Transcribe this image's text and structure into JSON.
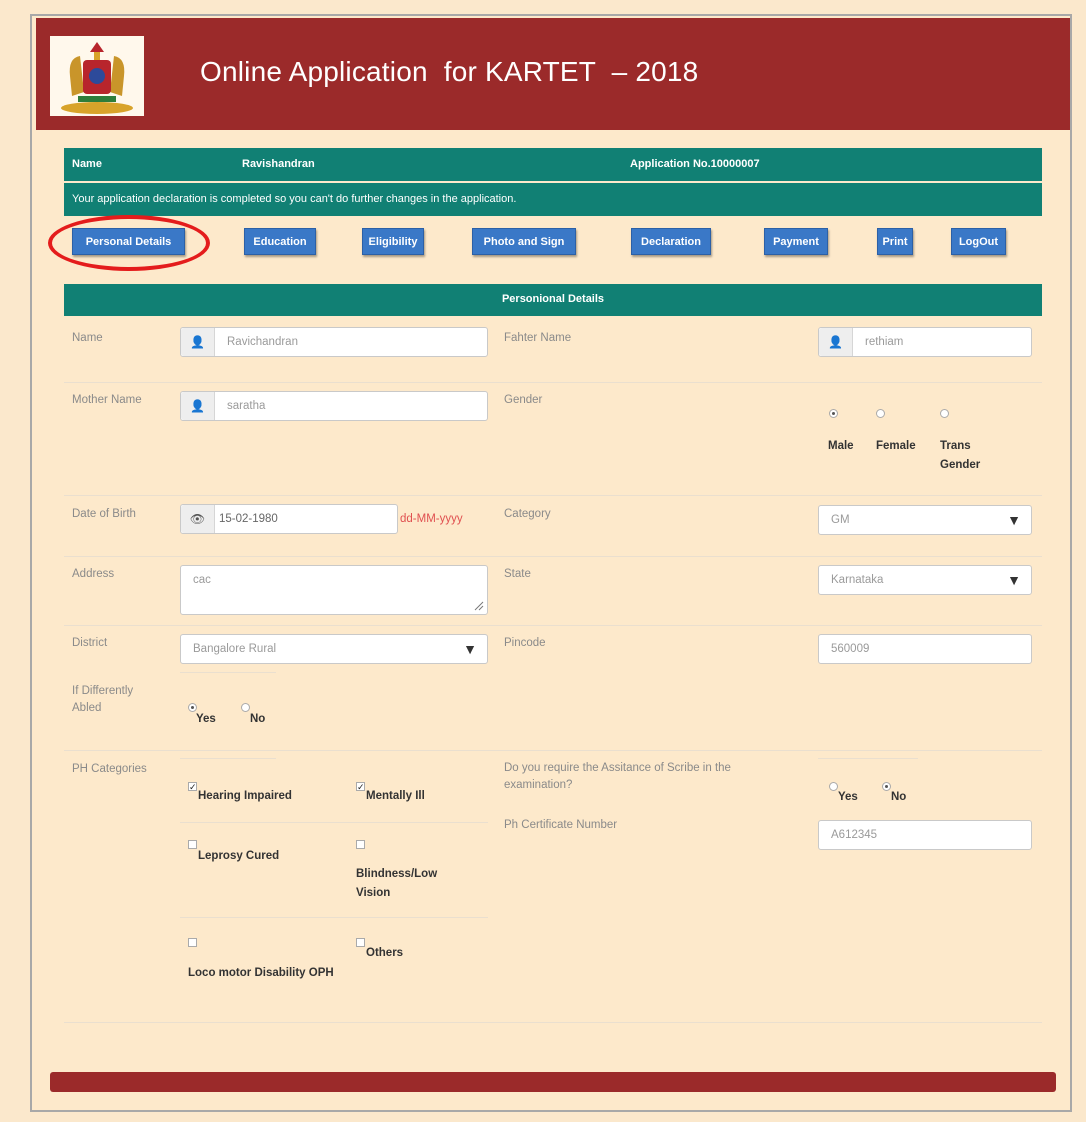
{
  "header": {
    "title": "Online Application  for KARTET  – 2018"
  },
  "info": {
    "name_label": "Name",
    "name_value": "Ravishandran",
    "application_no": "Application No.10000007",
    "notice": "Your application declaration is completed so you can't do further changes in the application."
  },
  "nav": [
    {
      "label": "Personal Details"
    },
    {
      "label": "Education"
    },
    {
      "label": "Eligibility"
    },
    {
      "label": "Photo and Sign"
    },
    {
      "label": "Declaration"
    },
    {
      "label": "Payment"
    },
    {
      "label": "Print"
    },
    {
      "label": "LogOut"
    }
  ],
  "section": {
    "title": "Personional Details"
  },
  "form": {
    "name": {
      "label": "Name",
      "value": "Ravichandran",
      "icon": "user-icon"
    },
    "father_name": {
      "label": "Fahter Name",
      "value": "rethiam",
      "icon": "user-icon"
    },
    "mother_name": {
      "label": "Mother Name",
      "value": "saratha",
      "icon": "user-icon"
    },
    "gender": {
      "label": "Gender",
      "options": [
        "Male",
        "Female",
        "Trans\nGender"
      ],
      "selected": "Male"
    },
    "dob": {
      "label": "Date of Birth",
      "value": "15-02-1980",
      "format_hint": "dd-MM-yyyy",
      "icon": "eye-icon"
    },
    "category": {
      "label": "Category",
      "value": "GM"
    },
    "address": {
      "label": "Address",
      "value": "cac"
    },
    "state": {
      "label": "State",
      "value": "Karnataka"
    },
    "district": {
      "label": "District",
      "value": "Bangalore Rural"
    },
    "pincode": {
      "label": "Pincode",
      "value": "560009"
    },
    "differently_abled": {
      "label": "If Differently Abled",
      "options": [
        "Yes",
        "No"
      ],
      "selected": "Yes"
    },
    "ph_categories": {
      "label": "PH Categories",
      "options": [
        {
          "label": "Hearing Impaired",
          "checked": true
        },
        {
          "label": "Mentally Ill",
          "checked": true
        },
        {
          "label": "Leprosy Cured",
          "checked": false
        },
        {
          "label": "Blindness/Low Vision",
          "checked": false
        },
        {
          "label": "Loco motor Disability OPH",
          "checked": false
        },
        {
          "label": "Others",
          "checked": false
        }
      ]
    },
    "scribe": {
      "label": "Do you require the Assitance of Scribe in the examination?",
      "options": [
        "Yes",
        "No"
      ],
      "selected": "No"
    },
    "ph_certificate": {
      "label": "Ph Certificate Number",
      "value": "A612345"
    }
  },
  "colors": {
    "header": "#9b2a2a",
    "teal": "#118074",
    "button": "#3a78c7",
    "highlight": "#e41c1c"
  }
}
